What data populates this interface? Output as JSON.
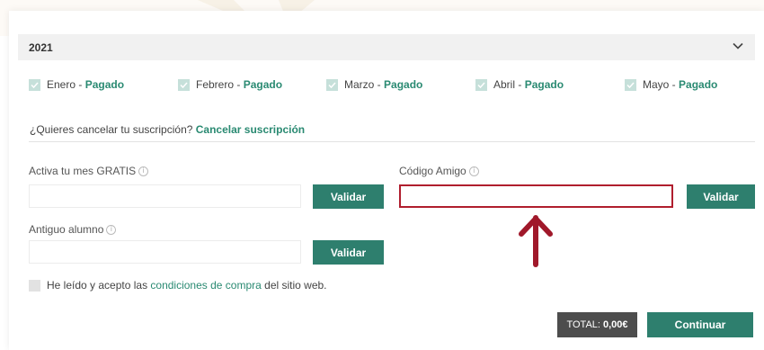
{
  "year_section": {
    "year": "2021"
  },
  "months": [
    {
      "name": "Enero",
      "separator": " - ",
      "status": "Pagado"
    },
    {
      "name": "Febrero",
      "separator": " - ",
      "status": "Pagado"
    },
    {
      "name": "Marzo",
      "separator": " - ",
      "status": "Pagado"
    },
    {
      "name": "Abril",
      "separator": " - ",
      "status": "Pagado"
    },
    {
      "name": "Mayo",
      "separator": " - ",
      "status": "Pagado"
    }
  ],
  "cancel": {
    "question": "¿Quieres cancelar tu suscripción? ",
    "link": "Cancelar suscripción"
  },
  "promo": {
    "free_month_label": "Activa tu mes GRATIS",
    "friend_code_label": "Código Amigo",
    "former_student_label": "Antiguo alumno",
    "validate_label": "Validar",
    "info_glyph": "i"
  },
  "terms": {
    "before": "He leído y acepto las ",
    "link": "condiciones de compra",
    "after": " del sitio web."
  },
  "checkout": {
    "total_label": "TOTAL:",
    "total_value": "0,00€",
    "continue_label": "Continuar"
  },
  "colors": {
    "accent": "#2e7f6e",
    "highlight_border": "#b01e2e",
    "arrow": "#a0182a"
  },
  "icons": {
    "checkbox_checked": "check-icon",
    "checkbox_unchecked": "checkbox-empty",
    "info": "info-icon",
    "expand": "chevron-down-icon",
    "annotation": "arrow-up-icon"
  }
}
